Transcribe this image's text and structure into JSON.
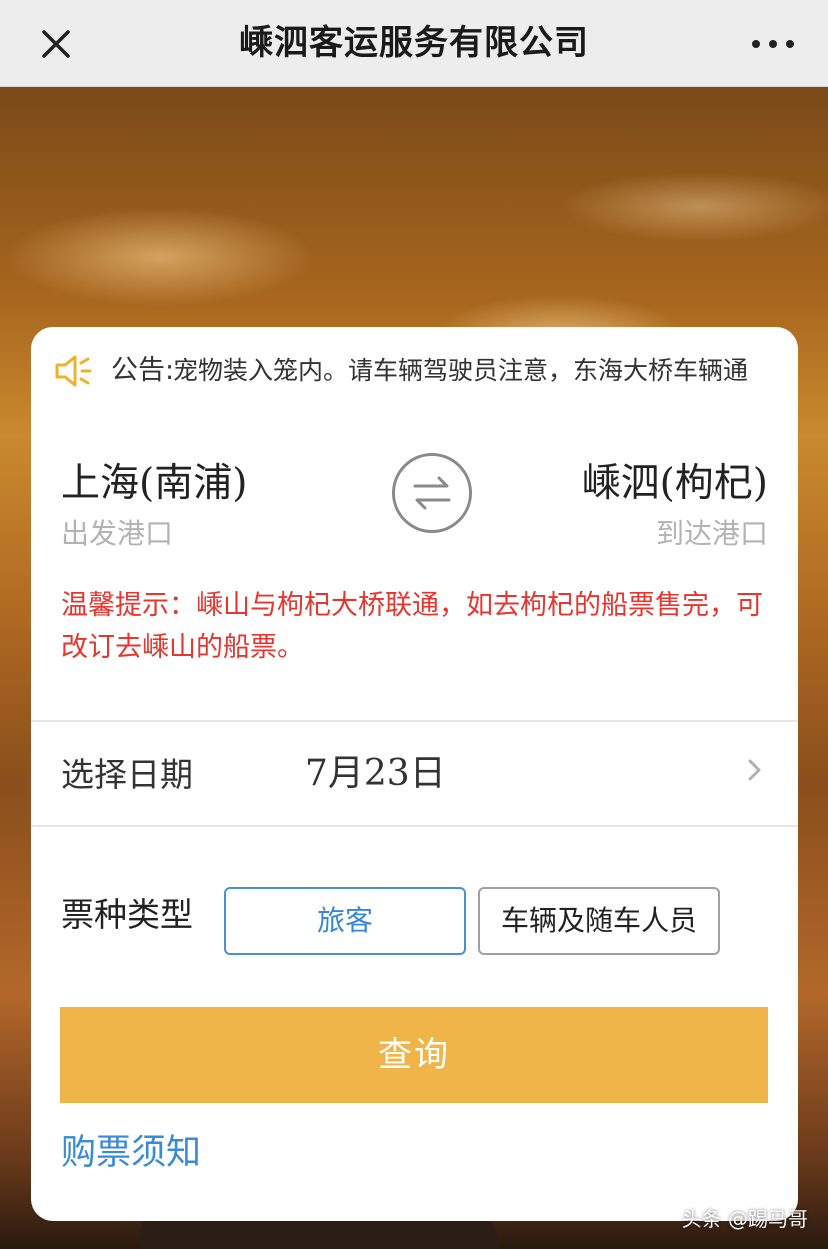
{
  "header": {
    "title": "嵊泗客运服务有限公司"
  },
  "notice": {
    "label": "公告:",
    "text": "宠物装入笼内。请车辆驾驶员注意，东海大桥车辆通"
  },
  "route": {
    "from_port": "上海(南浦)",
    "from_label": "出发港口",
    "to_port": "嵊泗(枸杞)",
    "to_label": "到达港口"
  },
  "tip": "温馨提示：嵊山与枸杞大桥联通，如去枸杞的船票售完，可改订去嵊山的船票。",
  "date": {
    "label": "选择日期",
    "value": "7月23日"
  },
  "ticket_type": {
    "label": "票种类型",
    "options": [
      "旅客",
      "车辆及随车人员"
    ],
    "selected": "旅客"
  },
  "query_button": "查询",
  "purchase_notice_link": "购票须知",
  "watermark": "头条 @踢马哥",
  "colors": {
    "accent_orange": "#f0b548",
    "tip_red": "#e53630",
    "link_blue": "#3a8ad6"
  }
}
